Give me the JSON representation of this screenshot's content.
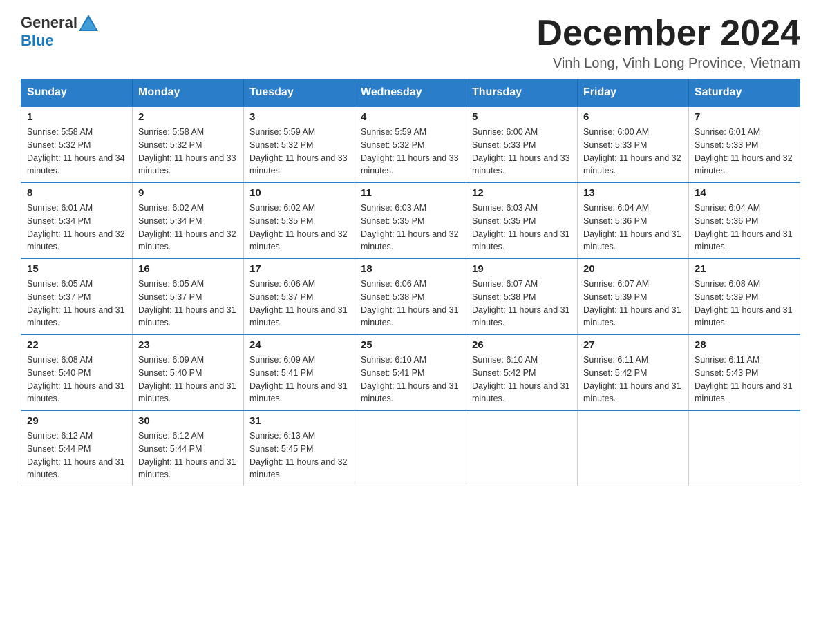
{
  "header": {
    "logo_text_general": "General",
    "logo_text_blue": "Blue",
    "month_title": "December 2024",
    "subtitle": "Vinh Long, Vinh Long Province, Vietnam"
  },
  "calendar": {
    "days_of_week": [
      "Sunday",
      "Monday",
      "Tuesday",
      "Wednesday",
      "Thursday",
      "Friday",
      "Saturday"
    ],
    "weeks": [
      [
        {
          "day": "1",
          "sunrise": "5:58 AM",
          "sunset": "5:32 PM",
          "daylight": "11 hours and 34 minutes."
        },
        {
          "day": "2",
          "sunrise": "5:58 AM",
          "sunset": "5:32 PM",
          "daylight": "11 hours and 33 minutes."
        },
        {
          "day": "3",
          "sunrise": "5:59 AM",
          "sunset": "5:32 PM",
          "daylight": "11 hours and 33 minutes."
        },
        {
          "day": "4",
          "sunrise": "5:59 AM",
          "sunset": "5:32 PM",
          "daylight": "11 hours and 33 minutes."
        },
        {
          "day": "5",
          "sunrise": "6:00 AM",
          "sunset": "5:33 PM",
          "daylight": "11 hours and 33 minutes."
        },
        {
          "day": "6",
          "sunrise": "6:00 AM",
          "sunset": "5:33 PM",
          "daylight": "11 hours and 32 minutes."
        },
        {
          "day": "7",
          "sunrise": "6:01 AM",
          "sunset": "5:33 PM",
          "daylight": "11 hours and 32 minutes."
        }
      ],
      [
        {
          "day": "8",
          "sunrise": "6:01 AM",
          "sunset": "5:34 PM",
          "daylight": "11 hours and 32 minutes."
        },
        {
          "day": "9",
          "sunrise": "6:02 AM",
          "sunset": "5:34 PM",
          "daylight": "11 hours and 32 minutes."
        },
        {
          "day": "10",
          "sunrise": "6:02 AM",
          "sunset": "5:35 PM",
          "daylight": "11 hours and 32 minutes."
        },
        {
          "day": "11",
          "sunrise": "6:03 AM",
          "sunset": "5:35 PM",
          "daylight": "11 hours and 32 minutes."
        },
        {
          "day": "12",
          "sunrise": "6:03 AM",
          "sunset": "5:35 PM",
          "daylight": "11 hours and 31 minutes."
        },
        {
          "day": "13",
          "sunrise": "6:04 AM",
          "sunset": "5:36 PM",
          "daylight": "11 hours and 31 minutes."
        },
        {
          "day": "14",
          "sunrise": "6:04 AM",
          "sunset": "5:36 PM",
          "daylight": "11 hours and 31 minutes."
        }
      ],
      [
        {
          "day": "15",
          "sunrise": "6:05 AM",
          "sunset": "5:37 PM",
          "daylight": "11 hours and 31 minutes."
        },
        {
          "day": "16",
          "sunrise": "6:05 AM",
          "sunset": "5:37 PM",
          "daylight": "11 hours and 31 minutes."
        },
        {
          "day": "17",
          "sunrise": "6:06 AM",
          "sunset": "5:37 PM",
          "daylight": "11 hours and 31 minutes."
        },
        {
          "day": "18",
          "sunrise": "6:06 AM",
          "sunset": "5:38 PM",
          "daylight": "11 hours and 31 minutes."
        },
        {
          "day": "19",
          "sunrise": "6:07 AM",
          "sunset": "5:38 PM",
          "daylight": "11 hours and 31 minutes."
        },
        {
          "day": "20",
          "sunrise": "6:07 AM",
          "sunset": "5:39 PM",
          "daylight": "11 hours and 31 minutes."
        },
        {
          "day": "21",
          "sunrise": "6:08 AM",
          "sunset": "5:39 PM",
          "daylight": "11 hours and 31 minutes."
        }
      ],
      [
        {
          "day": "22",
          "sunrise": "6:08 AM",
          "sunset": "5:40 PM",
          "daylight": "11 hours and 31 minutes."
        },
        {
          "day": "23",
          "sunrise": "6:09 AM",
          "sunset": "5:40 PM",
          "daylight": "11 hours and 31 minutes."
        },
        {
          "day": "24",
          "sunrise": "6:09 AM",
          "sunset": "5:41 PM",
          "daylight": "11 hours and 31 minutes."
        },
        {
          "day": "25",
          "sunrise": "6:10 AM",
          "sunset": "5:41 PM",
          "daylight": "11 hours and 31 minutes."
        },
        {
          "day": "26",
          "sunrise": "6:10 AM",
          "sunset": "5:42 PM",
          "daylight": "11 hours and 31 minutes."
        },
        {
          "day": "27",
          "sunrise": "6:11 AM",
          "sunset": "5:42 PM",
          "daylight": "11 hours and 31 minutes."
        },
        {
          "day": "28",
          "sunrise": "6:11 AM",
          "sunset": "5:43 PM",
          "daylight": "11 hours and 31 minutes."
        }
      ],
      [
        {
          "day": "29",
          "sunrise": "6:12 AM",
          "sunset": "5:44 PM",
          "daylight": "11 hours and 31 minutes."
        },
        {
          "day": "30",
          "sunrise": "6:12 AM",
          "sunset": "5:44 PM",
          "daylight": "11 hours and 31 minutes."
        },
        {
          "day": "31",
          "sunrise": "6:13 AM",
          "sunset": "5:45 PM",
          "daylight": "11 hours and 32 minutes."
        },
        null,
        null,
        null,
        null
      ]
    ]
  }
}
